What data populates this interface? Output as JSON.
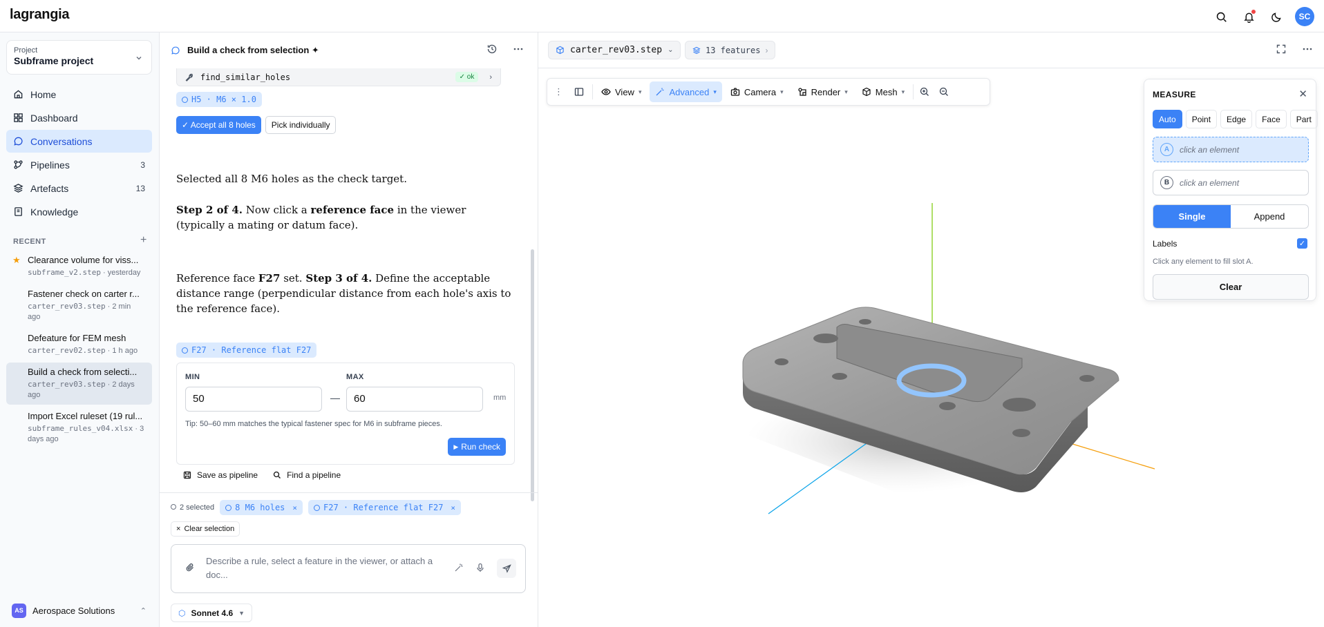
{
  "app": {
    "logo": "lagrangia",
    "avatar_initials": "SC"
  },
  "sidebar": {
    "project_label": "Project",
    "project_name": "Subframe project",
    "nav": [
      {
        "label": "Home",
        "icon": "home-icon"
      },
      {
        "label": "Dashboard",
        "icon": "dashboard-icon"
      },
      {
        "label": "Conversations",
        "icon": "chat-icon"
      },
      {
        "label": "Pipelines",
        "icon": "pipelines-icon",
        "count": "3"
      },
      {
        "label": "Artefacts",
        "icon": "layers-icon",
        "count": "13"
      },
      {
        "label": "Knowledge",
        "icon": "book-icon"
      }
    ],
    "recent_heading": "RECENT",
    "recent": [
      {
        "title": "Clearance volume for viss...",
        "sub_file": "subframe_v2.step",
        "sub_time": " · yesterday"
      },
      {
        "title": "Fastener check on carter r...",
        "sub_file": "carter_rev03.step",
        "sub_time": " · 2 min ago"
      },
      {
        "title": "Defeature for FEM mesh",
        "sub_file": "carter_rev02.step",
        "sub_time": " · 1 h ago"
      },
      {
        "title": "Build a check from selecti...",
        "sub_file": "carter_rev03.step",
        "sub_time": " · 2 days ago"
      },
      {
        "title": "Import Excel ruleset (19 rul...",
        "sub_file": "subframe_rules_v04.xlsx",
        "sub_time": " · 3 days ago"
      }
    ],
    "org_initials": "AS",
    "org_name": "Aerospace Solutions"
  },
  "chat": {
    "title": "Build a check from selection ✦",
    "tool_name": "find_similar_holes",
    "tool_status": "ok",
    "holes_chip": "H5 · M6 × 1.0",
    "accept_label": "✓ Accept all 8 holes",
    "pick_label": "Pick individually",
    "msg1": "Selected all 8 M6 holes as the check target.",
    "msg2_step": "Step 2 of 4.",
    "msg2_a": " Now click a ",
    "msg2_bold": "reference face",
    "msg2_b": " in the viewer (typically a mating or datum face).",
    "msg3_a": "Reference face ",
    "msg3_face": "F27",
    "msg3_b": " set. ",
    "msg3_step": "Step 3 of 4.",
    "msg3_c": " Define the acceptable distance range (perpendicular distance from each hole's axis to the reference face).",
    "face_chip": "F27 · Reference flat F27",
    "min_label": "MIN",
    "max_label": "MAX",
    "min_value": "50",
    "max_value": "60",
    "unit": "mm",
    "tip": "Tip: 50–60 mm matches the typical fastener spec for M6 in subframe pieces.",
    "run_label": "Run check",
    "save_pipeline": "Save as pipeline",
    "find_pipeline": "Find a pipeline",
    "selected_count": "2 selected",
    "sel_chip_1": "8 M6 holes",
    "sel_chip_2": "F27 · Reference flat F27",
    "clear_selection": "Clear selection",
    "composer_placeholder": "Describe a rule, select a feature in the viewer, or attach a doc...",
    "model": "Sonnet 4.6"
  },
  "viewer": {
    "file": "carter_rev03.step",
    "features": "13 features",
    "toolbar": {
      "view": "View",
      "advanced": "Advanced",
      "camera": "Camera",
      "render": "Render",
      "mesh": "Mesh"
    },
    "axis_colors": {
      "x": "#f59e0b",
      "y": "#84cc16",
      "z": "#0ea5e9"
    }
  },
  "measure": {
    "title": "MEASURE",
    "modes": [
      "Auto",
      "Point",
      "Edge",
      "Face",
      "Part"
    ],
    "slot_a_badge": "A",
    "slot_a": "click an element",
    "slot_b_badge": "B",
    "slot_b": "click an element",
    "single": "Single",
    "append": "Append",
    "labels": "Labels",
    "hint": "Click any element to fill slot A.",
    "clear": "Clear"
  }
}
